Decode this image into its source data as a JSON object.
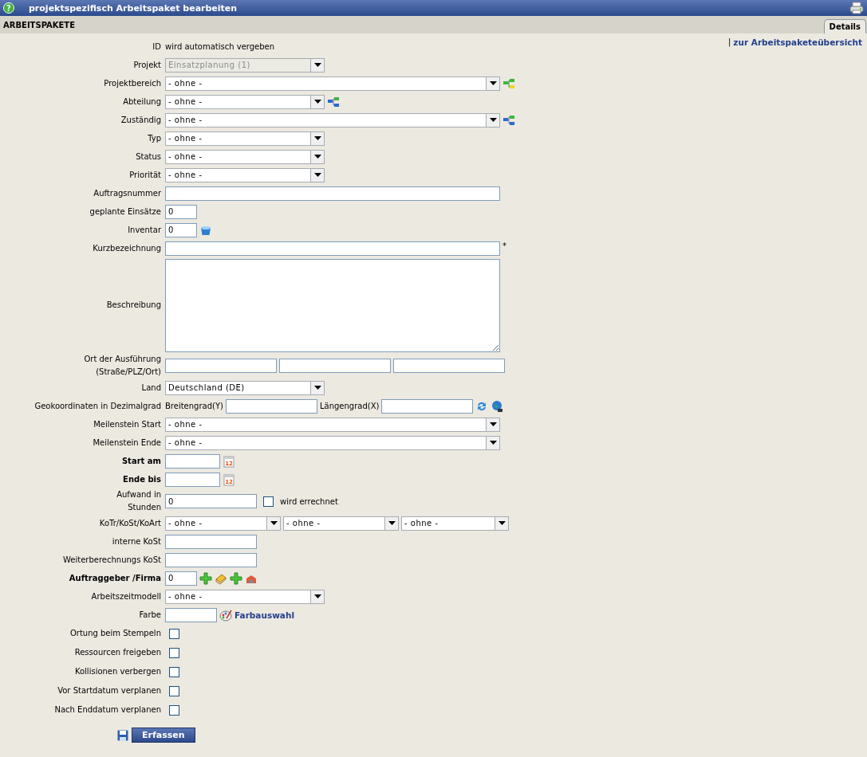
{
  "window": {
    "title": "projektspezifisch Arbeitspaket bearbeiten",
    "help_icon": "?"
  },
  "section": {
    "title": "ARBEITSPAKETE"
  },
  "tabs": [
    {
      "label": "Details",
      "selected": true
    }
  ],
  "overview_link": {
    "separator": "|",
    "text": "zur Arbeitspaketeübersicht"
  },
  "rows": [
    {
      "label": "ID",
      "bold": false,
      "controls": [
        {
          "kind": "text",
          "text": "wird automatisch vergeben"
        }
      ]
    },
    {
      "label": "Projekt",
      "bold": false,
      "controls": [
        {
          "kind": "select",
          "value": "Einsatzplanung (1)",
          "disabled": true
        }
      ]
    },
    {
      "label": "Projektbereich",
      "bold": false,
      "controls": [
        {
          "kind": "select",
          "value": "- ohne -",
          "disabled": false
        },
        {
          "kind": "tree"
        }
      ]
    },
    {
      "label": "Abteilung",
      "bold": false,
      "controls": [
        {
          "kind": "select",
          "value": "- ohne -",
          "disabled": false
        },
        {
          "kind": "orgtree"
        }
      ]
    },
    {
      "label": "Zuständig",
      "bold": false,
      "controls": [
        {
          "kind": "select",
          "value": "- ohne -",
          "disabled": false
        },
        {
          "kind": "orgtree"
        }
      ]
    },
    {
      "label": "Typ",
      "bold": false,
      "controls": [
        {
          "kind": "select",
          "value": "- ohne -",
          "disabled": false
        }
      ]
    },
    {
      "label": "Status",
      "bold": false,
      "controls": [
        {
          "kind": "select",
          "value": "- ohne -",
          "disabled": false
        }
      ]
    },
    {
      "label": "Priorität",
      "bold": false,
      "controls": [
        {
          "kind": "select",
          "value": "- ohne -",
          "disabled": false
        }
      ]
    },
    {
      "label": "Auftragsnummer",
      "bold": false,
      "controls": [
        {
          "kind": "input"
        }
      ]
    },
    {
      "label": "geplante Einsätze",
      "bold": false,
      "controls": [
        {
          "kind": "input",
          "value": "0"
        }
      ]
    },
    {
      "label": "Inventar",
      "bold": false,
      "controls": [
        {
          "kind": "input",
          "value": "0"
        },
        {
          "kind": "inventory"
        }
      ]
    },
    {
      "label": "Kurzbezeichnung",
      "bold": false,
      "controls": [
        {
          "kind": "input"
        },
        {
          "kind": "required",
          "text": "*"
        }
      ]
    },
    {
      "label": "Beschreibung",
      "bold": false,
      "controls": [
        {
          "kind": "textarea"
        }
      ]
    },
    {
      "label": "Ort der Ausführung\n(Straße/PLZ/Ort)",
      "bold": false,
      "controls": [
        {
          "kind": "input"
        },
        {
          "kind": "input"
        },
        {
          "kind": "input"
        }
      ]
    },
    {
      "label": "Land",
      "bold": false,
      "controls": [
        {
          "kind": "select",
          "value": "Deutschland (DE)",
          "disabled": false
        }
      ]
    },
    {
      "label": "Geokoordinaten in Dezimalgrad",
      "bold": false,
      "controls": [
        {
          "kind": "text",
          "text": "Breitengrad(Y)"
        },
        {
          "kind": "input"
        },
        {
          "kind": "text",
          "text": "Längengrad(X)"
        },
        {
          "kind": "input"
        },
        {
          "kind": "refresh"
        },
        {
          "kind": "globe"
        }
      ]
    },
    {
      "label": "Meilenstein Start",
      "bold": false,
      "controls": [
        {
          "kind": "select",
          "value": "- ohne -",
          "disabled": false
        }
      ]
    },
    {
      "label": "Meilenstein Ende",
      "bold": false,
      "controls": [
        {
          "kind": "select",
          "value": "- ohne -",
          "disabled": false
        }
      ]
    },
    {
      "label": "Start am",
      "bold": true,
      "controls": [
        {
          "kind": "input"
        },
        {
          "kind": "calendar",
          "text": "12"
        }
      ]
    },
    {
      "label": "Ende bis",
      "bold": true,
      "controls": [
        {
          "kind": "input"
        },
        {
          "kind": "calendar",
          "text": "12"
        }
      ]
    },
    {
      "label": "Aufwand in\nStunden",
      "bold": false,
      "controls": [
        {
          "kind": "input",
          "value": "0"
        },
        {
          "kind": "checkbox",
          "checked": false
        },
        {
          "kind": "text",
          "text": "wird errechnet"
        }
      ]
    },
    {
      "label": "KoTr/KoSt/KoArt",
      "bold": false,
      "controls": [
        {
          "kind": "select",
          "value": "- ohne -",
          "disabled": false
        },
        {
          "kind": "select",
          "value": "- ohne -",
          "disabled": false
        },
        {
          "kind": "select",
          "value": "- ohne -",
          "disabled": false
        }
      ]
    },
    {
      "label": "interne KoSt",
      "bold": false,
      "controls": [
        {
          "kind": "input"
        }
      ]
    },
    {
      "label": "Weiterberechnungs KoSt",
      "bold": false,
      "controls": [
        {
          "kind": "input"
        }
      ]
    },
    {
      "label": "Auftraggeber /Firma",
      "bold": true,
      "controls": [
        {
          "kind": "input",
          "value": "0"
        },
        {
          "kind": "plus"
        },
        {
          "kind": "book"
        },
        {
          "kind": "plus"
        },
        {
          "kind": "building"
        }
      ]
    },
    {
      "label": "Arbeitszeitmodell",
      "bold": false,
      "controls": [
        {
          "kind": "select",
          "value": "- ohne -",
          "disabled": false
        }
      ]
    },
    {
      "label": "Farbe",
      "bold": false,
      "controls": [
        {
          "kind": "input"
        },
        {
          "kind": "palette"
        },
        {
          "kind": "link",
          "text": "Farbauswahl"
        }
      ]
    },
    {
      "label": "Ortung beim Stempeln",
      "bold": false,
      "controls": [
        {
          "kind": "checkbox",
          "checked": false
        }
      ]
    },
    {
      "label": "Ressourcen freigeben",
      "bold": false,
      "controls": [
        {
          "kind": "checkbox",
          "checked": false
        }
      ]
    },
    {
      "label": "Kollisionen verbergen",
      "bold": false,
      "controls": [
        {
          "kind": "checkbox",
          "checked": false
        }
      ]
    },
    {
      "label": "Vor Startdatum verplanen",
      "bold": false,
      "controls": [
        {
          "kind": "checkbox",
          "checked": false
        }
      ]
    },
    {
      "label": "Nach Enddatum verplanen",
      "bold": false,
      "controls": [
        {
          "kind": "checkbox",
          "checked": false
        }
      ]
    }
  ],
  "submit": {
    "label": "Erfassen"
  }
}
